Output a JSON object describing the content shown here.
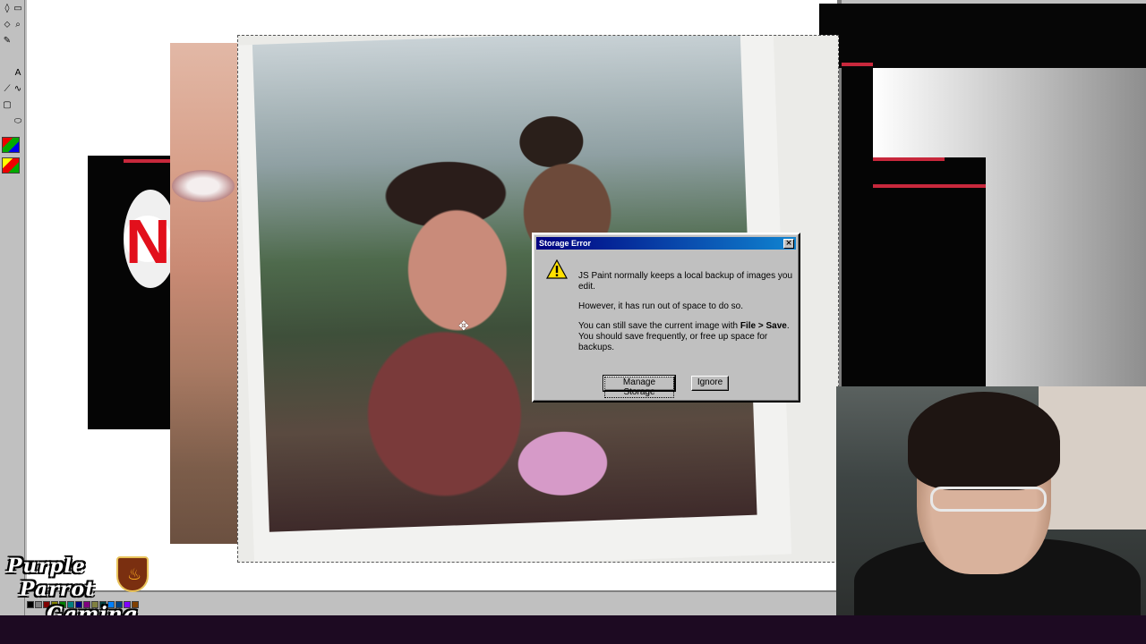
{
  "dialog": {
    "title": "Storage Error",
    "close_label": "×",
    "message_1": "JS Paint normally keeps a local backup of images you edit.",
    "message_2": "However, it has run out of space to do so.",
    "message_3_prefix": "You can still save the current image with ",
    "message_3_bold": "File > Save",
    "message_3_suffix": ". You should save frequently, or free up space for backups.",
    "manage_storage_label": "Manage Storage",
    "ignore_label": "Ignore"
  },
  "toolbox": {
    "tools": [
      "◊",
      "▭",
      "⬦",
      "⌕",
      "✎",
      "A",
      "⟋",
      "∿",
      "▢",
      "⬭",
      "▭",
      "⬯"
    ]
  },
  "logo": {
    "line1": "Purple",
    "line2": "Parrot",
    "line3": "Gaming"
  },
  "overlay_text": {
    "netflix_letter": "N"
  },
  "colors": {
    "dialog_face": "#c0c0c0",
    "titlebar_start": "#000080",
    "titlebar_end": "#1084d0",
    "status_bar": "#1d0a22"
  },
  "icons": {
    "warning": "warning-icon",
    "close": "close-icon",
    "cursor": "move-cursor-icon"
  }
}
